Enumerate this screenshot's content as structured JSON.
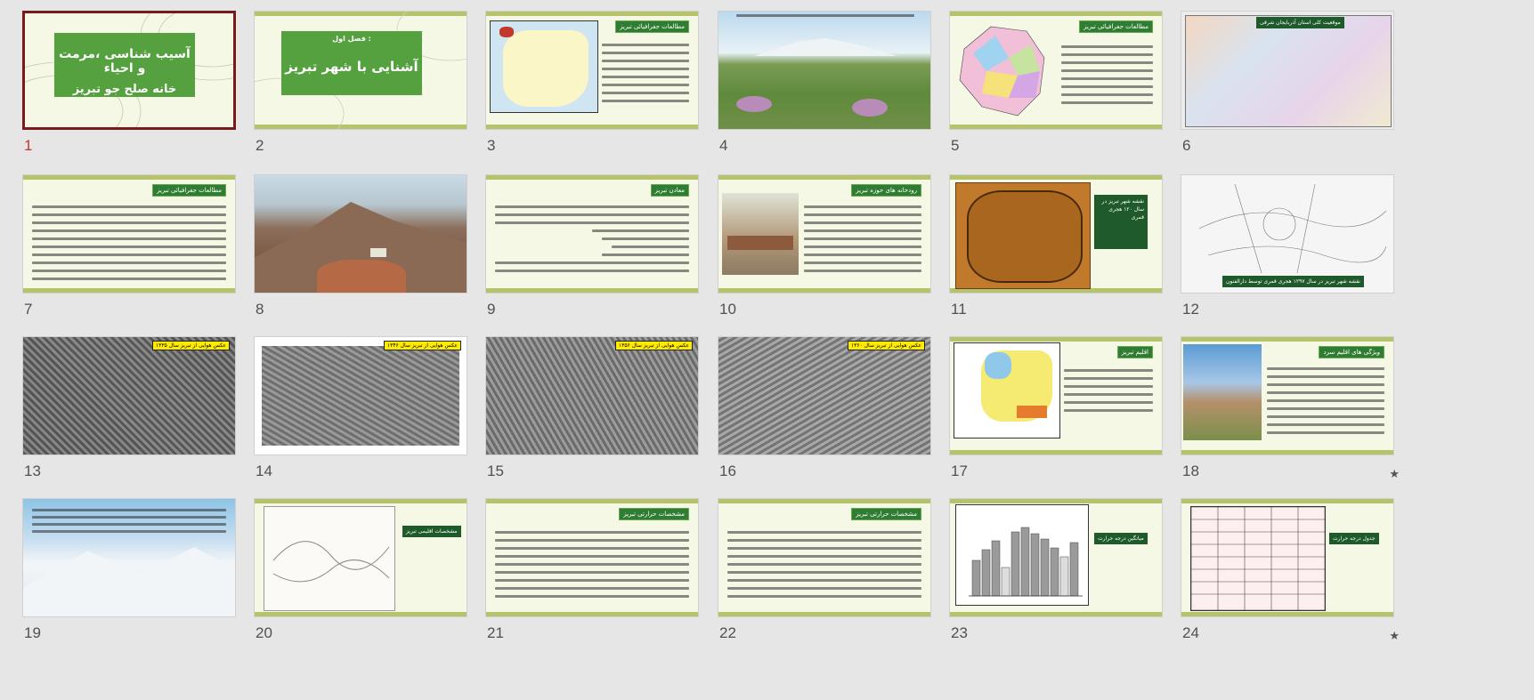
{
  "slides": [
    {
      "num": "1",
      "title": "آسیب شناسی ،مرمت و احیاء",
      "subtitle": "خانه صلح جو تبریز"
    },
    {
      "num": "2",
      "title": "فصل اول :",
      "subtitle": "آشنایی با شهر تبریز"
    },
    {
      "num": "3",
      "tag": "مطالعات جغرافیائی تبریز"
    },
    {
      "num": "4"
    },
    {
      "num": "5",
      "tag": "مطالعات جغرافیائی تبریز"
    },
    {
      "num": "6",
      "tag": "موقعیت کلی استان آذربایجان شرقی"
    },
    {
      "num": "7",
      "tag": "مطالعات جغرافیائی تبریز"
    },
    {
      "num": "8"
    },
    {
      "num": "9",
      "tag": "معادن تبریز"
    },
    {
      "num": "10",
      "tag": "رودخانه های حوزه تبریز"
    },
    {
      "num": "11",
      "tag": "نقشه شهر تبریز در سال ۱۲۰ هجری قمری"
    },
    {
      "num": "12",
      "tag": "نقشه شهر تبریز در سال ۱۲۹۷ هجری قمری توسط دارالفنون"
    },
    {
      "num": "13",
      "tag": "عکس هوایی از تبریز سال ۱۳۳۵"
    },
    {
      "num": "14",
      "tag": "عکس هوایی از تبریز سال ۱۳۴۶"
    },
    {
      "num": "15",
      "tag": "عکس هوایی از تبریز سال ۱۳۵۶"
    },
    {
      "num": "16",
      "tag": "عکس هوایی از تبریز سال ۱۳۶۰"
    },
    {
      "num": "17",
      "tag": "اقلیم تبریز"
    },
    {
      "num": "18",
      "tag": "ویژگی های اقلیم سرد",
      "star": "★"
    },
    {
      "num": "19"
    },
    {
      "num": "20",
      "tag": "مشخصات اقلیمی تبریز"
    },
    {
      "num": "21",
      "tag": "مشخصات حرارتی تبریز"
    },
    {
      "num": "22",
      "tag": "مشخصات حرارتی تبریز"
    },
    {
      "num": "23",
      "tag": "میانگین درجه حرارت"
    },
    {
      "num": "24",
      "tag": "جدول درجه حرارت",
      "star": "★"
    }
  ]
}
